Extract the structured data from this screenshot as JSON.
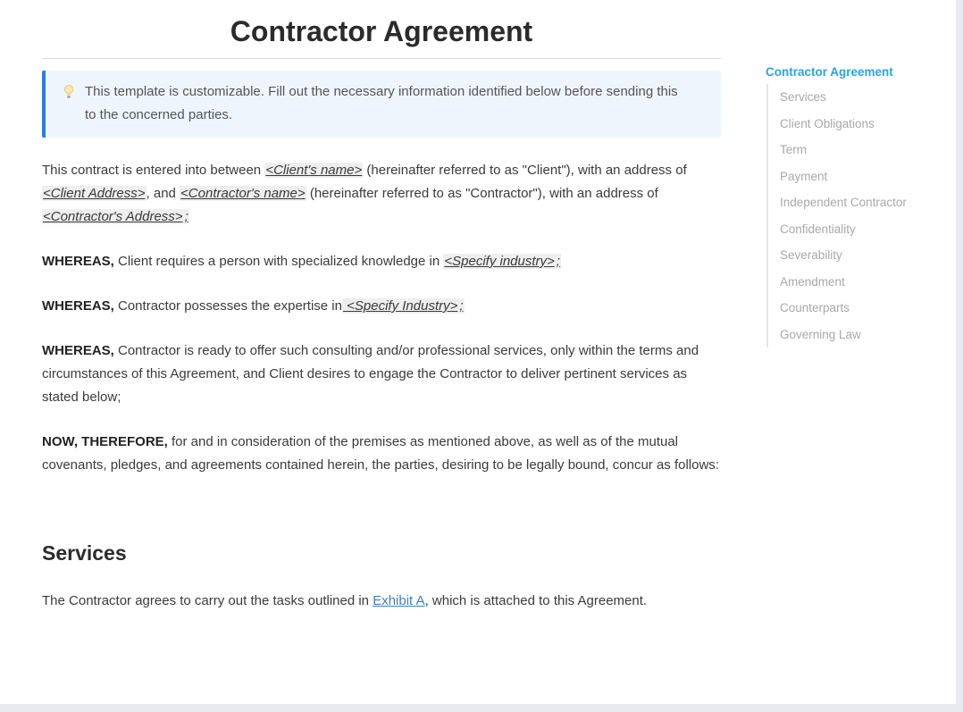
{
  "document": {
    "title": "Contractor Agreement",
    "callout": {
      "icon": "lightbulb-icon",
      "text": "This template is customizable. Fill out the necessary information identified below before sending this to the concerned parties."
    },
    "intro": {
      "t1": "This contract is entered into between ",
      "client_name": "<Client's name>",
      "t2": " (hereinafter referred to as \"Client\"), with an address of ",
      "client_address": "<Client Address>",
      "t3": ", and ",
      "contractor_name": "<Contractor's name>",
      "t4": " (hereinafter referred to as \"Contractor\"), with an address of ",
      "contractor_address": "<Contractor's Address>",
      "t5": ";"
    },
    "whereas1": {
      "bold": "WHEREAS,",
      "text": " Client requires a person with specialized knowledge in ",
      "placeholder": "<Specify industry>",
      "end": ";"
    },
    "whereas2": {
      "bold": "WHEREAS,",
      "text": " Contractor possesses the expertise in",
      "placeholder": " <Specify Industry>",
      "end": ";"
    },
    "whereas3": {
      "bold": "WHEREAS,",
      "text": " Contractor is ready to offer such consulting and/or professional services, only within the terms and circumstances of this Agreement, and Client desires to engage the Contractor to deliver pertinent services as stated below;"
    },
    "now_therefore": {
      "bold": "NOW, THEREFORE,",
      "text": " for and in consideration of the premises as mentioned above, as well as of the mutual covenants, pledges, and agreements contained herein, the parties, desiring to be legally bound, concur as follows:"
    },
    "services": {
      "heading": "Services",
      "t1": "The Contractor agrees to carry out the tasks outlined in ",
      "link": "Exhibit A",
      "t2": ", which is attached to this Agreement."
    }
  },
  "toc": {
    "title": "Contractor Agreement",
    "items": [
      "Services",
      "Client Obligations",
      "Term",
      "Payment",
      "Independent Contractor",
      "Confidentiality",
      "Severability",
      "Amendment",
      "Counterparts",
      "Governing Law"
    ]
  },
  "colors": {
    "accent": "#2aa3e0",
    "callout_border": "#2f7be0",
    "callout_bg": "#eef5fd",
    "link": "#3a7fc4"
  }
}
